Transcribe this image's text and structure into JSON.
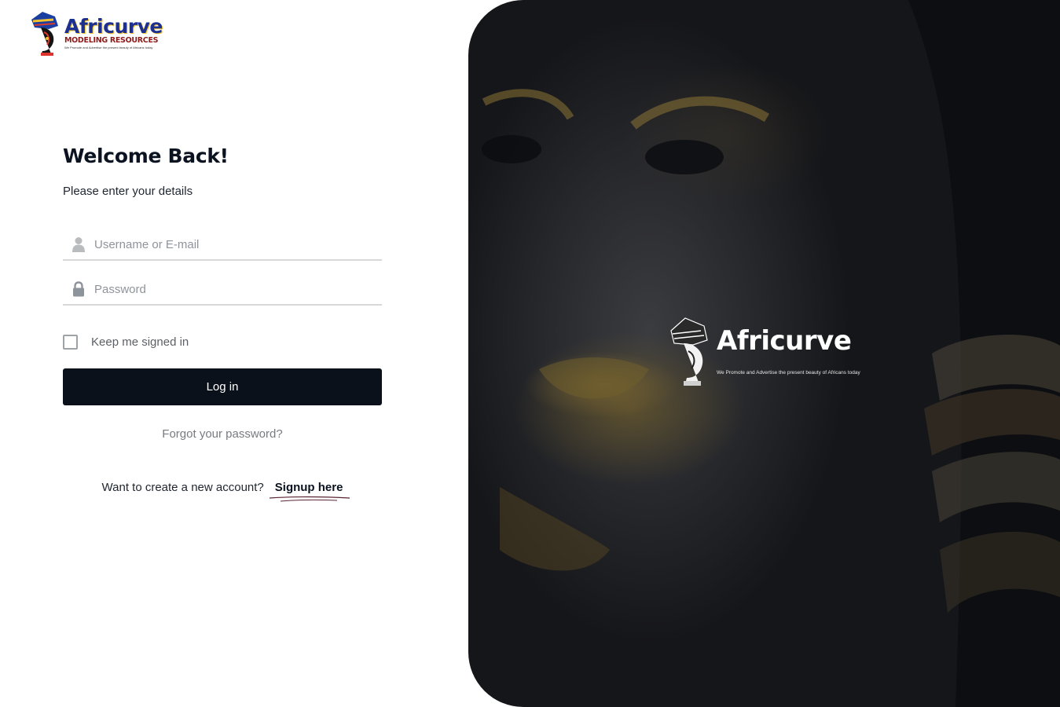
{
  "brand": {
    "logo_word": "Africurve",
    "logo_subtitle": "MODELING RESOURCES",
    "hero_tagline": "We Promote and Advertise the present beauty of Africans today"
  },
  "form": {
    "title": "Welcome Back!",
    "subtitle": "Please enter your details",
    "username_placeholder": "Username or E-mail",
    "password_placeholder": "Password",
    "remember_label": "Keep me signed in",
    "remember_checked": false,
    "login_label": "Log in",
    "forgot_label": "Forgot your password?",
    "signup_question": "Want to create a new account?",
    "signup_link": "Signup here"
  },
  "icons": {
    "username": "user-icon",
    "password": "lock-icon"
  },
  "colors": {
    "primary_button": "#0a111a",
    "input_border": "#d8d8d8",
    "hero_background": "#1a1b1f"
  }
}
